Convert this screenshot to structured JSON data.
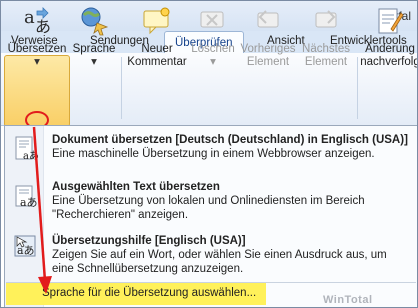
{
  "title": {
    "app_suffix": "Notfal"
  },
  "tabs": [
    {
      "label": "Verweise"
    },
    {
      "label": "Sendungen"
    },
    {
      "label": "Überprüfen"
    },
    {
      "label": "Ansicht"
    },
    {
      "label": "Entwicklertools"
    }
  ],
  "ribbon": {
    "translate": {
      "line1": "Übersetzen",
      "dropdown": "▾"
    },
    "language": {
      "label": "Sprache"
    },
    "new_comment": {
      "line1": "Neuer",
      "line2": "Kommentar"
    },
    "delete": {
      "label": "Löschen"
    },
    "previous": {
      "line1": "Vorheriges",
      "line2": "Element"
    },
    "next": {
      "line1": "Nächstes",
      "line2": "Element"
    },
    "track": {
      "line1": "Änderung",
      "line2": "nachverfolg"
    }
  },
  "menu": {
    "items": [
      {
        "title": "Dokument übersetzen [Deutsch (Deutschland) in Englisch (USA)]",
        "desc": [
          "Eine maschinelle Übersetzung in einem Webbrowser anzeigen."
        ]
      },
      {
        "title": "Ausgewählten Text übersetzen",
        "desc": [
          "Eine Übersetzung von lokalen und Onlinediensten im Bereich",
          "\"Recherchieren\" anzeigen."
        ]
      },
      {
        "title": "Übersetzungshilfe [Englisch (USA)]",
        "desc": [
          "Zeigen Sie auf ein Wort, oder wählen Sie einen Ausdruck aus, um",
          "eine Schnellübersetzung anzuzeigen."
        ]
      }
    ],
    "footer": "Sprache für die Übersetzung auswählen...",
    "watermark": "WinTotal"
  },
  "colors": {
    "highlight": "#fff15a",
    "arrow": "#e21c1c",
    "selected_button": "#f9cf66"
  }
}
